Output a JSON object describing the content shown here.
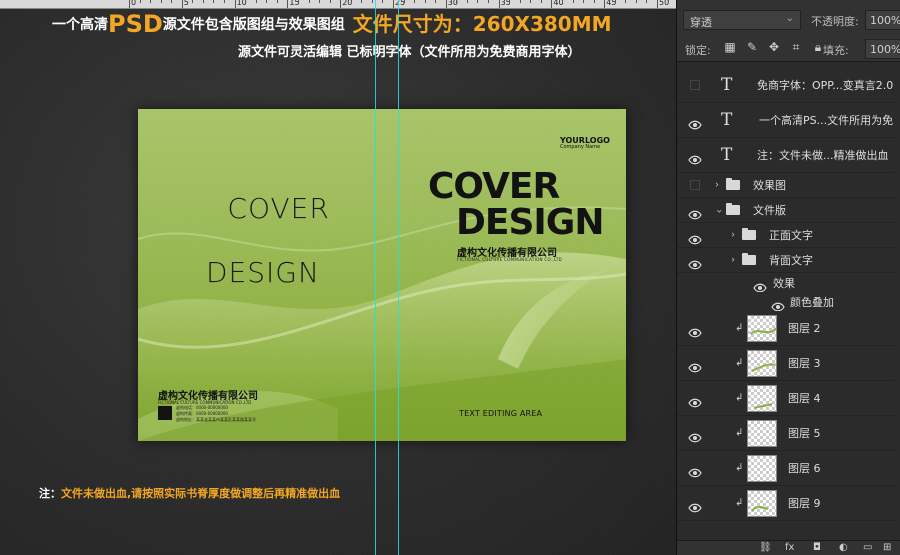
{
  "ruler": {
    "labels": [
      "0",
      "5",
      "10",
      "15",
      "20",
      "25",
      "30",
      "35",
      "40",
      "45",
      "50"
    ]
  },
  "header": {
    "line1_prefix": "一个高清",
    "line1_psd": "PSD",
    "line1_mid": "源文件包含版图组与效果图组",
    "line1_size": "文件尺寸为：260X380MM",
    "line2": "源文件可灵活编辑 已标明字体（文件所用为免费商用字体）"
  },
  "note": {
    "label": "注：",
    "text": "文件未做出血,请按照实际书脊厚度做调整后再精准做出血"
  },
  "cover": {
    "back_title_1": "COVER",
    "back_title_2": "DESIGN",
    "front_title_1": "COVER",
    "front_title_2": "DESIGN",
    "front_company": "虚构文化传播有限公司",
    "front_company_en": "FICTIONAL CULTURE COMMUNICATION CO.,LTD",
    "logo_main": "YOURLOGO",
    "logo_sub": "Company Name",
    "back_company": "虚构文化传播有限公司",
    "back_company_en": "FICTIONAL CULTURE COMMUNICATION CO.,LTD",
    "back_line_1": "虚构电话：0000-00000000",
    "back_line_2": "虚构传真：0000-00000000",
    "back_line_3": "虚构地址：某某省某某市某某区某某路某某号",
    "text_editing": "TEXT EDITING AREA"
  },
  "panel": {
    "blend_mode": "穿透",
    "opacity_label": "不透明度:",
    "opacity_value": "100%",
    "lock_label": "锁定:",
    "fill_label": "填充:",
    "fill_value": "100%",
    "layers": [
      {
        "name": "免商字体：OPP...变真言2.0",
        "type": "text",
        "visible": false
      },
      {
        "name": "一个高清PS...文件所用为免",
        "type": "text",
        "visible": true
      },
      {
        "name": "注：文件未做...精准做出血",
        "type": "text",
        "visible": true
      },
      {
        "name": "效果图",
        "type": "group",
        "visible": false,
        "expanded": false
      },
      {
        "name": "文件版",
        "type": "group",
        "visible": true,
        "expanded": true
      },
      {
        "name": "正面文字",
        "type": "group",
        "visible": true,
        "expanded": false
      },
      {
        "name": "背面文字",
        "type": "group",
        "visible": true,
        "expanded": false
      },
      {
        "name": "效果",
        "type": "effect",
        "visible": true
      },
      {
        "name": "颜色叠加",
        "type": "effect",
        "visible": true
      },
      {
        "name": "图层 2",
        "type": "image",
        "visible": true
      },
      {
        "name": "图层 3",
        "type": "image",
        "visible": true
      },
      {
        "name": "图层 4",
        "type": "image",
        "visible": true
      },
      {
        "name": "图层 5",
        "type": "image",
        "visible": true
      },
      {
        "name": "图层 6",
        "type": "image",
        "visible": true
      },
      {
        "name": "图层 9",
        "type": "image",
        "visible": true
      }
    ]
  },
  "colors": {
    "accent": "#f2a623",
    "cover_green": "#9cbb59",
    "guide": "#1de3e0"
  }
}
